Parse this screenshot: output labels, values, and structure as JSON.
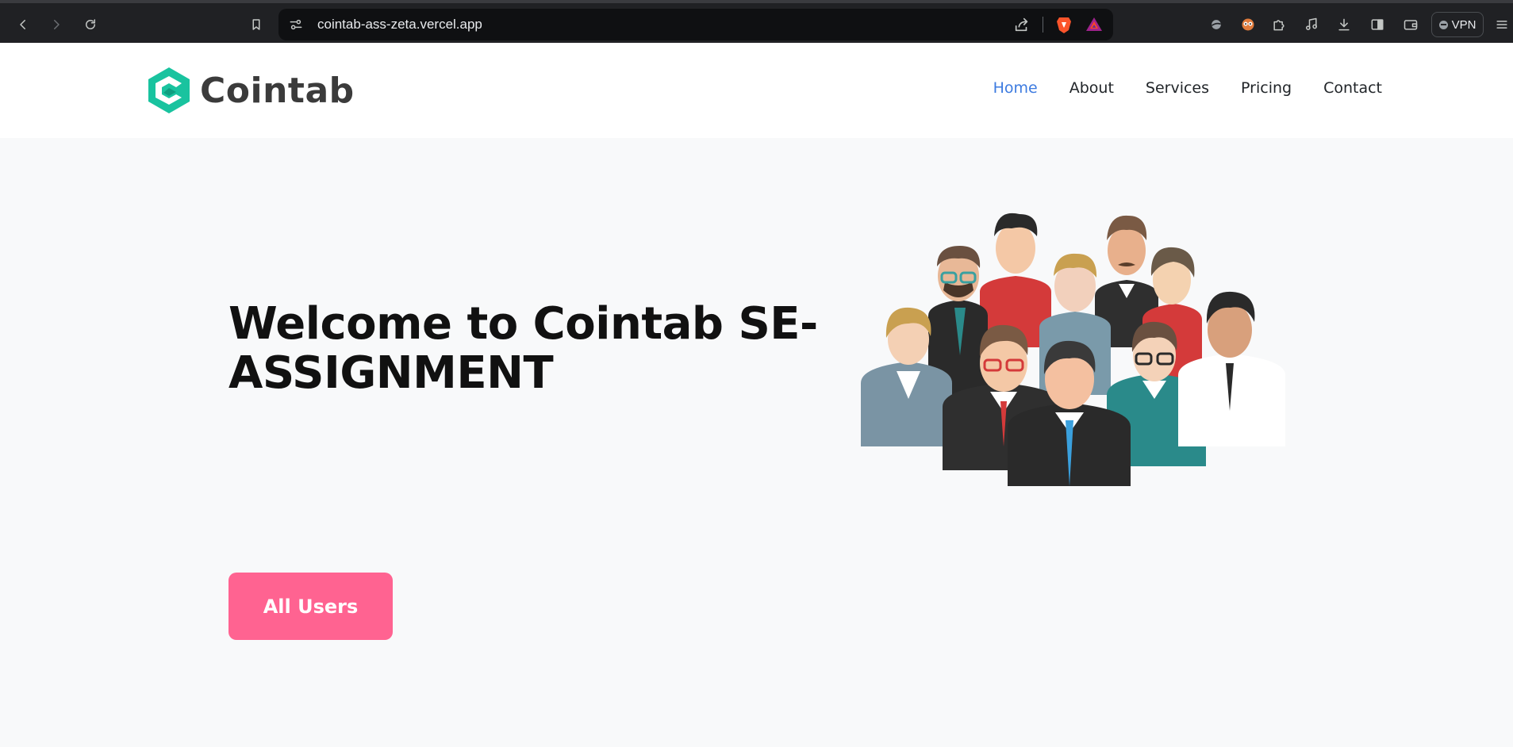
{
  "browser": {
    "url": "cointab-ass-zeta.vercel.app",
    "vpn_label": "VPN",
    "icons": {
      "back": "back-arrow-icon",
      "forward": "forward-arrow-icon",
      "reload": "reload-icon",
      "bookmark": "bookmark-icon",
      "site_settings": "site-settings-icon",
      "share": "share-icon",
      "brave_shields": "brave-shield-icon",
      "rewards": "brave-rewards-icon",
      "toolbar": [
        "extension-globe-icon",
        "extension-owl-icon",
        "extensions-puzzle-icon",
        "media-music-icon",
        "downloads-icon",
        "sidebar-icon",
        "wallet-icon",
        "menu-icon"
      ]
    }
  },
  "header": {
    "logo_text": "Cointab",
    "brand_color": "#19c39f",
    "nav": {
      "home": "Home",
      "about": "About",
      "services": "Services",
      "pricing": "Pricing",
      "contact": "Contact"
    },
    "active_item": "Home",
    "active_color": "#3d7be0"
  },
  "hero": {
    "title": "Welcome to Cointab SE-ASSIGNMENT",
    "button_label": "All Users",
    "button_color": "#ff6391",
    "illustration": "group-of-people-illustration"
  }
}
